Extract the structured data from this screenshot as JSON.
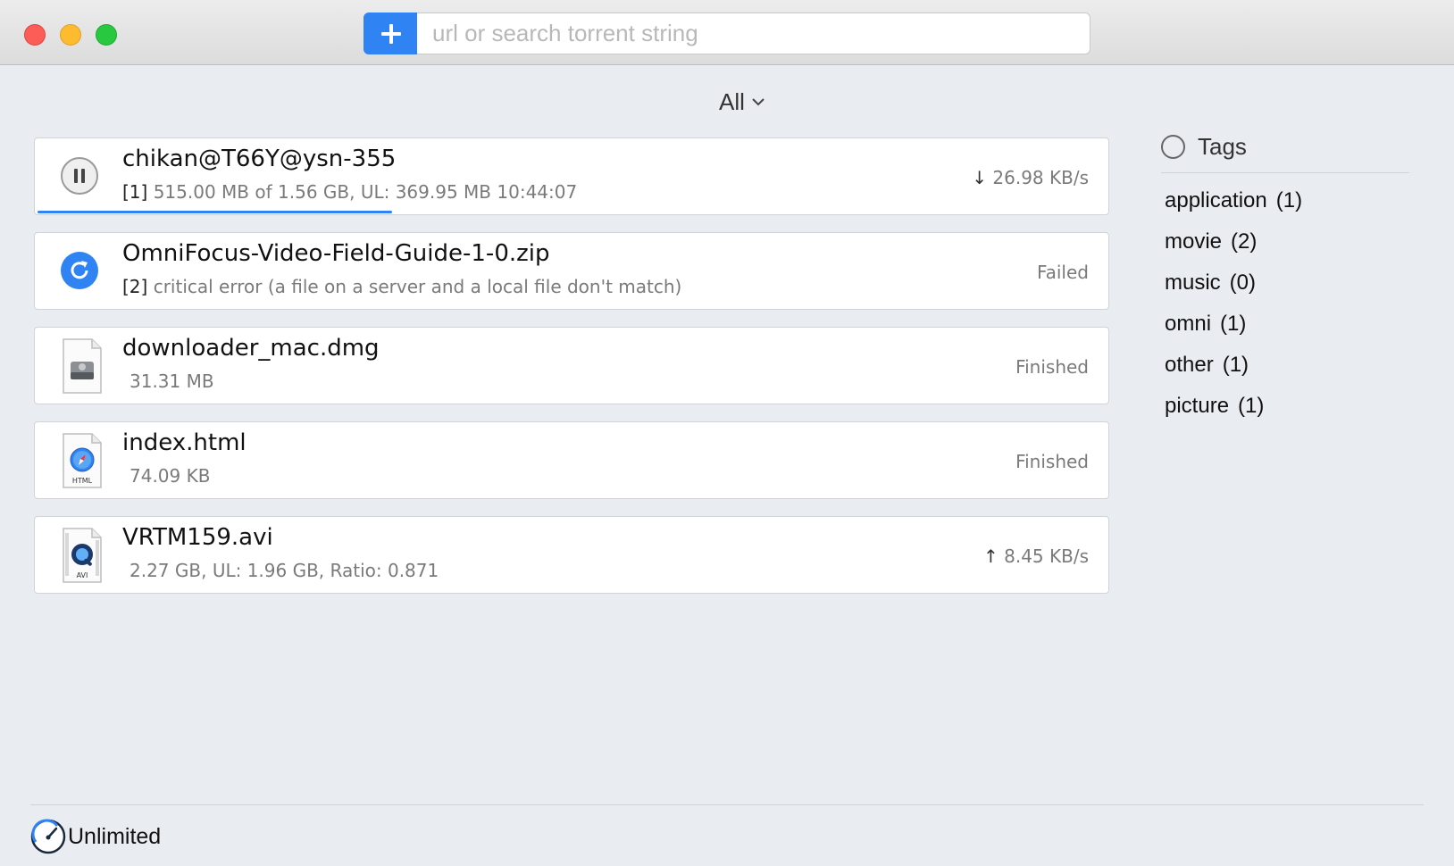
{
  "colors": {
    "accent": "#2f83f2",
    "close": "#fc5d56",
    "minimize": "#fdbc2f",
    "zoom": "#28c840"
  },
  "toolbar": {
    "add_icon": "plus-icon",
    "search_placeholder": "url or search torrent string",
    "search_value": ""
  },
  "filter": {
    "selected": "All",
    "icon": "chevron-down-icon"
  },
  "downloads": [
    {
      "name": "chikan@T66Y@ysn-355",
      "index": "[1]",
      "details": "515.00 MB of 1.56 GB, UL: 369.95 MB 10:44:07",
      "status_arrow": "↓",
      "status": "26.98 KB/s",
      "icon": "pause-icon",
      "progress": 0.33
    },
    {
      "name": "OmniFocus-Video-Field-Guide-1-0.zip",
      "index": "[2]",
      "details": "critical error (a file on a server and a local file  don't match)",
      "status": "Failed",
      "icon": "retry-icon"
    },
    {
      "name": "downloader_mac.dmg",
      "details": "31.31 MB",
      "status": "Finished",
      "icon": "disk-image-file-icon"
    },
    {
      "name": "index.html",
      "details": "74.09 KB",
      "status": "Finished",
      "icon": "html-file-icon",
      "icon_label": "HTML"
    },
    {
      "name": "VRTM159.avi",
      "details": "2.27 GB, UL: 1.96 GB, Ratio: 0.871",
      "status_arrow": "↑",
      "status": "8.45 KB/s",
      "icon": "avi-file-icon",
      "icon_label": "AVI"
    }
  ],
  "tags": {
    "title": "Tags",
    "items": [
      {
        "name": "application",
        "count": "(1)"
      },
      {
        "name": "movie",
        "count": "(2)"
      },
      {
        "name": "music",
        "count": "(0)"
      },
      {
        "name": "omni",
        "count": "(1)"
      },
      {
        "name": "other",
        "count": "(1)"
      },
      {
        "name": "picture",
        "count": "(1)"
      }
    ]
  },
  "footer": {
    "speed_label": "Unlimited",
    "icon": "speedometer-icon"
  }
}
